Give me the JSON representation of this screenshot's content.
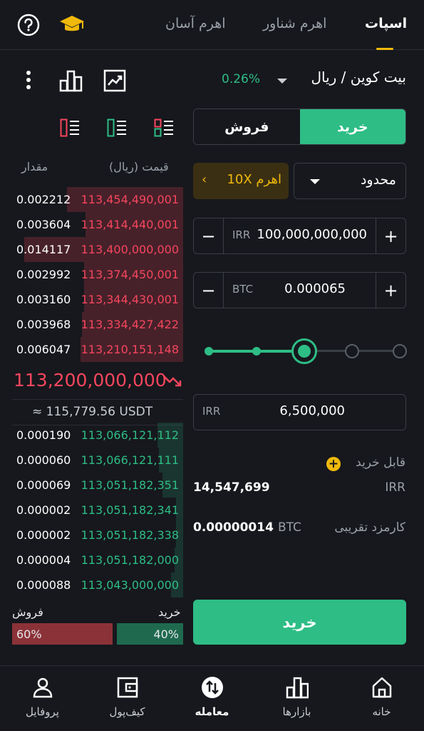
{
  "tabs": {
    "spot": "اسپات",
    "float_leverage": "اهرم شناور",
    "easy_leverage": "اهرم آسان"
  },
  "market": {
    "pair": "بیت کوین / ریال",
    "change": "0.26%"
  },
  "trade_side": {
    "buy": "خرید",
    "sell": "فروش"
  },
  "orderbook": {
    "price_header": "قیمت (ریال)",
    "qty_header": "مقدار",
    "asks": [
      {
        "qty": "0.002212",
        "price": "113,454,490,001",
        "depth": 0.68
      },
      {
        "qty": "0.003604",
        "price": "113,414,440,001",
        "depth": 0.57
      },
      {
        "qty": "0.014117",
        "price": "113,400,000,000",
        "depth": 0.93
      },
      {
        "qty": "0.002992",
        "price": "113,374,450,001",
        "depth": 0.58
      },
      {
        "qty": "0.003160",
        "price": "113,344,430,001",
        "depth": 0.58
      },
      {
        "qty": "0.003968",
        "price": "113,334,427,422",
        "depth": 0.59
      },
      {
        "qty": "0.006047",
        "price": "113,210,151,148",
        "depth": 0.6
      }
    ],
    "last_price": "113,200,000,000",
    "usdt_equiv": "≈ 115,779.56 USDT",
    "bids": [
      {
        "qty": "0.000190",
        "price": "113,066,121,112",
        "depth": 0.15
      },
      {
        "qty": "0.000060",
        "price": "113,066,121,111",
        "depth": 0.14
      },
      {
        "qty": "0.000069",
        "price": "113,051,182,351",
        "depth": 0.12
      },
      {
        "qty": "0.000002",
        "price": "113,051,182,341",
        "depth": 0.04
      },
      {
        "qty": "0.000002",
        "price": "113,051,182,338",
        "depth": 0.04
      },
      {
        "qty": "0.000004",
        "price": "113,051,182,000",
        "depth": 0.05
      },
      {
        "qty": "0.000088",
        "price": "113,043,000,000",
        "depth": 0.07
      }
    ],
    "ratio": {
      "sell_label": "فروش",
      "buy_label": "خرید",
      "sell_pct": "60%",
      "buy_pct": "40%"
    }
  },
  "form": {
    "order_type": "محدود",
    "leverage": "اهرم 10X",
    "leverage_chevron": "‹",
    "price": {
      "currency": "IRR",
      "value": "100,000,000,000"
    },
    "amount": {
      "currency": "BTC",
      "value": "0.000065"
    },
    "slider_percent": 0.5,
    "total": {
      "currency": "IRR",
      "value": "6,500,000"
    },
    "available_label": "قابل خرید",
    "available_value": "14,547,699",
    "available_currency": "IRR",
    "fee_label": "کارمزد تقریبی",
    "fee_value": "0.00000014",
    "fee_currency": "BTC",
    "submit": "خرید"
  },
  "nav": {
    "home": "خانه",
    "markets": "بازارها",
    "trade": "معامله",
    "wallet": "کیف‌پول",
    "profile": "پروفایل"
  },
  "colors": {
    "buy": "#2ebd85",
    "sell": "#f6465d",
    "accent": "#f0b90b",
    "background": "#16181d"
  },
  "icons": [
    "help-icon",
    "academy-icon",
    "more-icon",
    "chart-bars-icon",
    "line-chart-icon",
    "orderbook-asks-icon",
    "orderbook-bids-icon",
    "orderbook-both-icon",
    "trend-down-icon",
    "home-icon",
    "markets-icon",
    "trade-icon",
    "wallet-icon",
    "profile-icon"
  ]
}
